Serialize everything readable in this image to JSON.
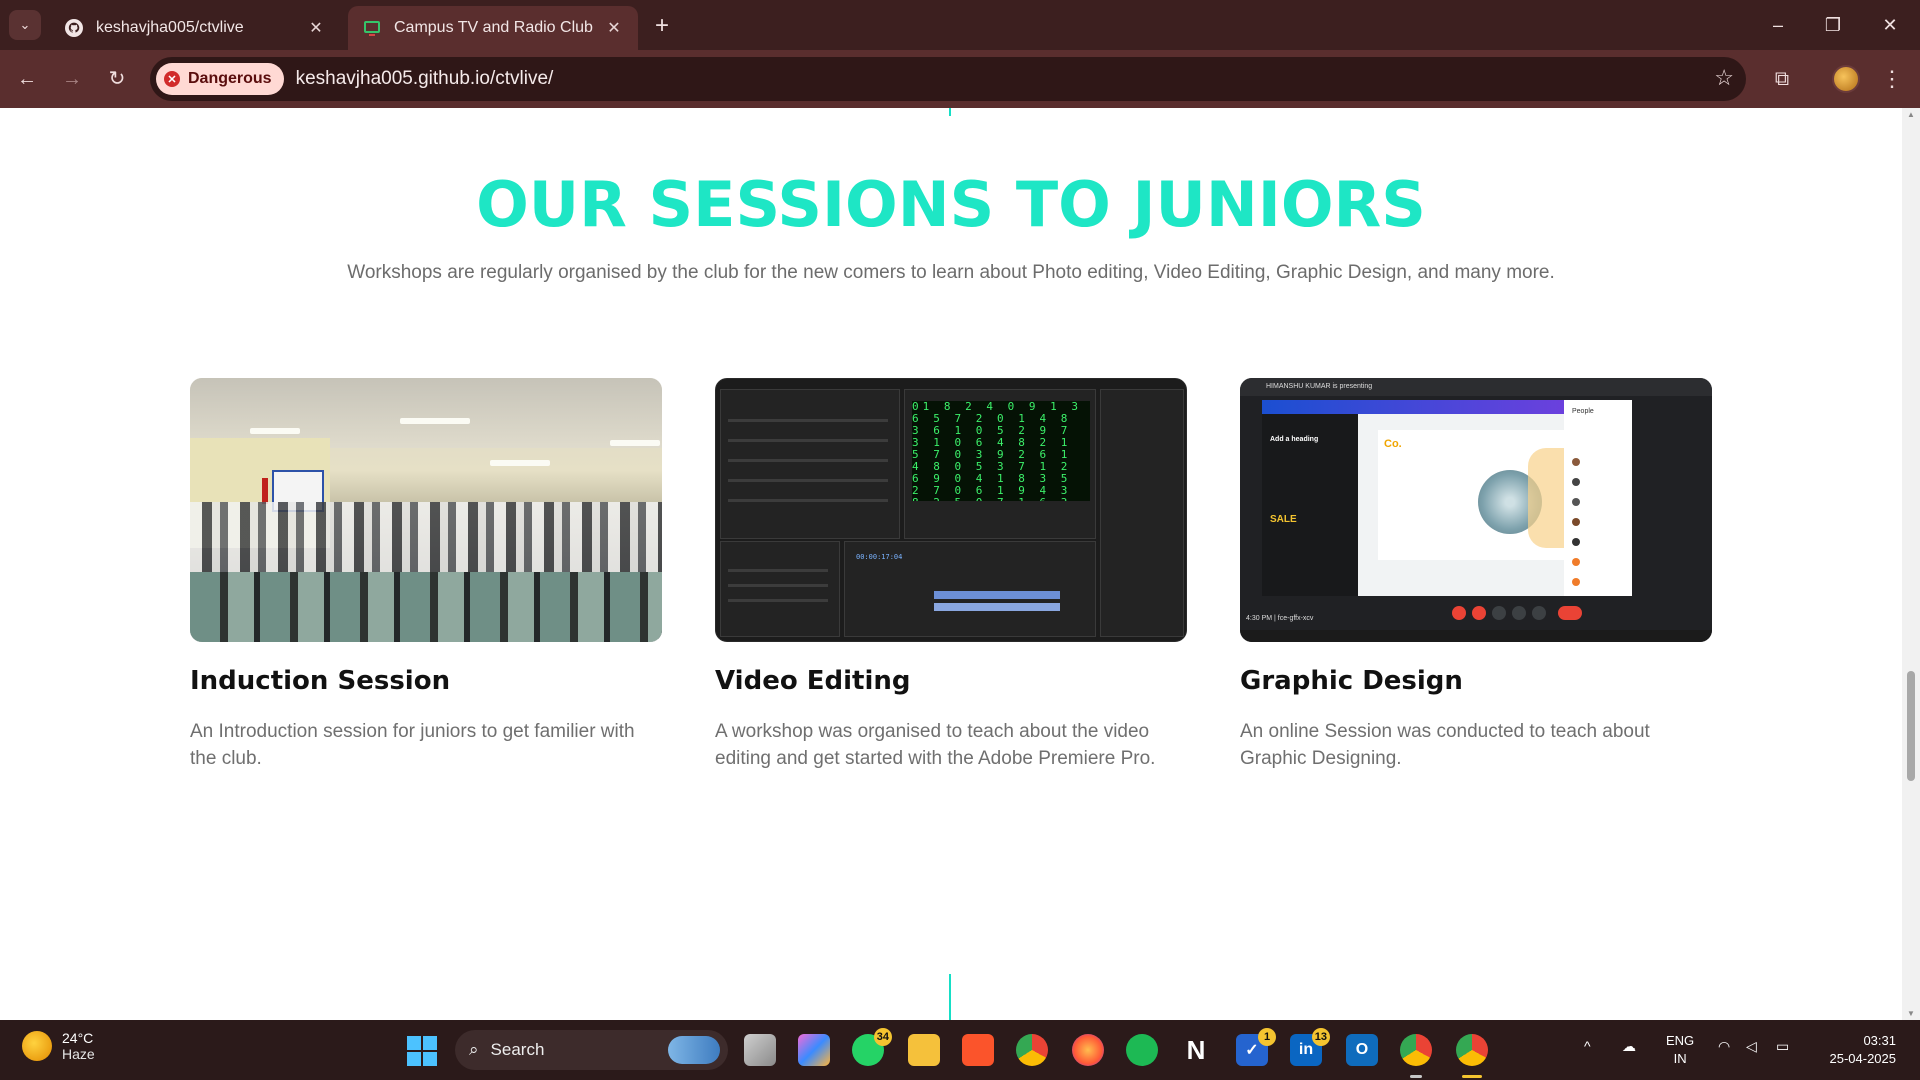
{
  "browser": {
    "tabs": [
      {
        "title": "keshavjha005/ctvlive",
        "icon": "github-icon"
      },
      {
        "title": "Campus TV and Radio Club",
        "icon": "site-favicon"
      }
    ],
    "new_tab": "+",
    "security_label": "Dangerous",
    "url": "keshavjha005.github.io/ctvlive/"
  },
  "page": {
    "heading": "OUR SESSIONS TO JUNIORS",
    "subtitle": "Workshops are regularly organised by the club for the new comers to learn about Photo editing, Video Editing, Graphic Design, and many more.",
    "cards": [
      {
        "title": "Induction Session",
        "description": "An Introduction session for juniors to get familier with the club."
      },
      {
        "title": "Video Editing",
        "description": "A workshop was organised to teach about the video editing and get started with the Adobe Premiere Pro."
      },
      {
        "title": "Graphic Design",
        "description": "An online Session was conducted to teach about Graphic Designing."
      }
    ],
    "screenshot_text": {
      "gd_presenting": "HIMANSHU KUMAR is presenting",
      "gd_time": "4:30 PM | fce-gffx-xcv",
      "gd_heading": "Add a heading",
      "gd_people": "People",
      "pr_timecode": "00:00:17:04"
    }
  },
  "taskbar": {
    "weather_temp": "24°C",
    "weather_desc": "Haze",
    "search_placeholder": "Search",
    "badges": {
      "whatsapp": "34",
      "todo": "1",
      "linkedin": "13"
    },
    "lang_line1": "ENG",
    "lang_line2": "IN",
    "time": "03:31",
    "date": "25-04-2025"
  },
  "colors": {
    "accent": "#1ee6c5",
    "chrome_dark": "#3c1f1f",
    "danger_chip": "#ffd9d4"
  }
}
